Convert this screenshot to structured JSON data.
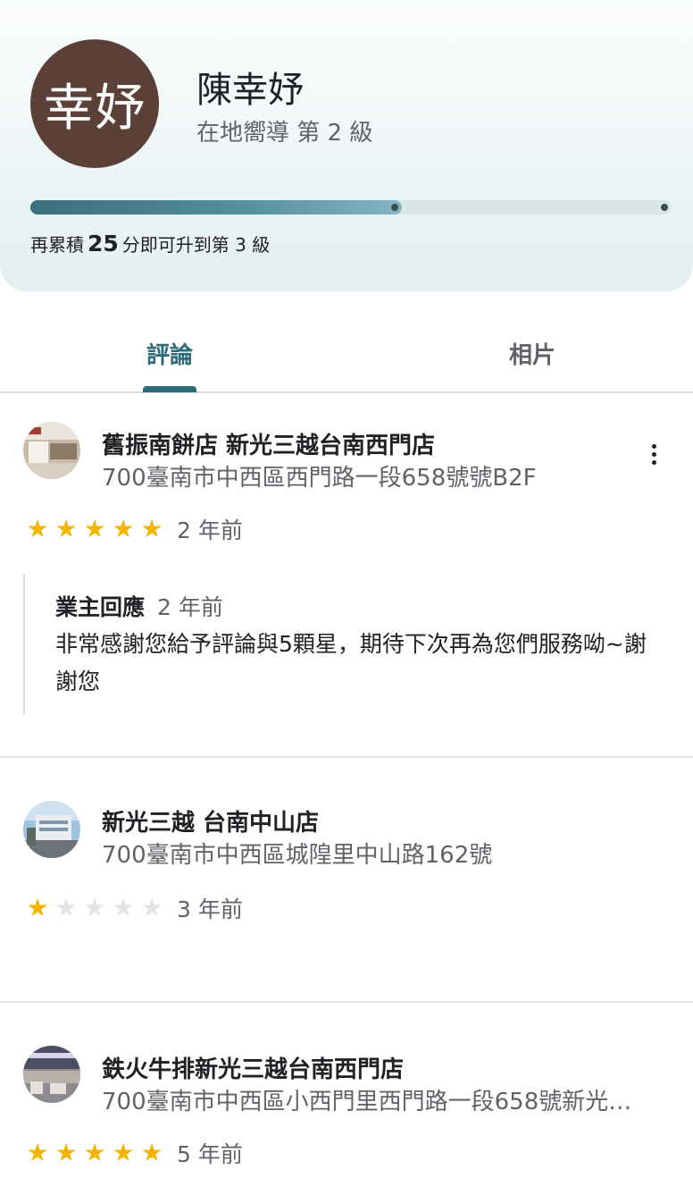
{
  "profile": {
    "avatar_text": "幸妤",
    "name": "陳幸妤",
    "level": "在地嚮導 第 2 級",
    "progress_fraction": 0.58,
    "progress_prefix": "再累積",
    "progress_points": "25",
    "progress_suffix": "分即可升到第 3 級"
  },
  "tabs": [
    {
      "label": "評論",
      "active": true
    },
    {
      "label": "相片",
      "active": false
    }
  ],
  "reviews": [
    {
      "place": "舊振南餅店 新光三越台南西門店",
      "address": "700臺南市中西區西門路一段658號號B2F",
      "rating": 5,
      "time": "2 年前",
      "reply": {
        "label": "業主回應",
        "time": "2 年前",
        "text": "非常感謝您給予評論與5顆星，期待下次再為您們服務呦~謝謝您"
      }
    },
    {
      "place": "新光三越 台南中山店",
      "address": "700臺南市中西區城隍里中山路162號",
      "rating": 1,
      "time": "3 年前"
    },
    {
      "place": "鉄火牛排新光三越台南西門店",
      "address": "700臺南市中西區小西門里西門路一段658號新光…",
      "rating": 5,
      "time": "5 年前"
    }
  ],
  "colors": {
    "accent": "#2d6b78",
    "star_on": "#f4b400",
    "star_off": "#e3e3e3",
    "avatar_bg": "#5b4038"
  }
}
